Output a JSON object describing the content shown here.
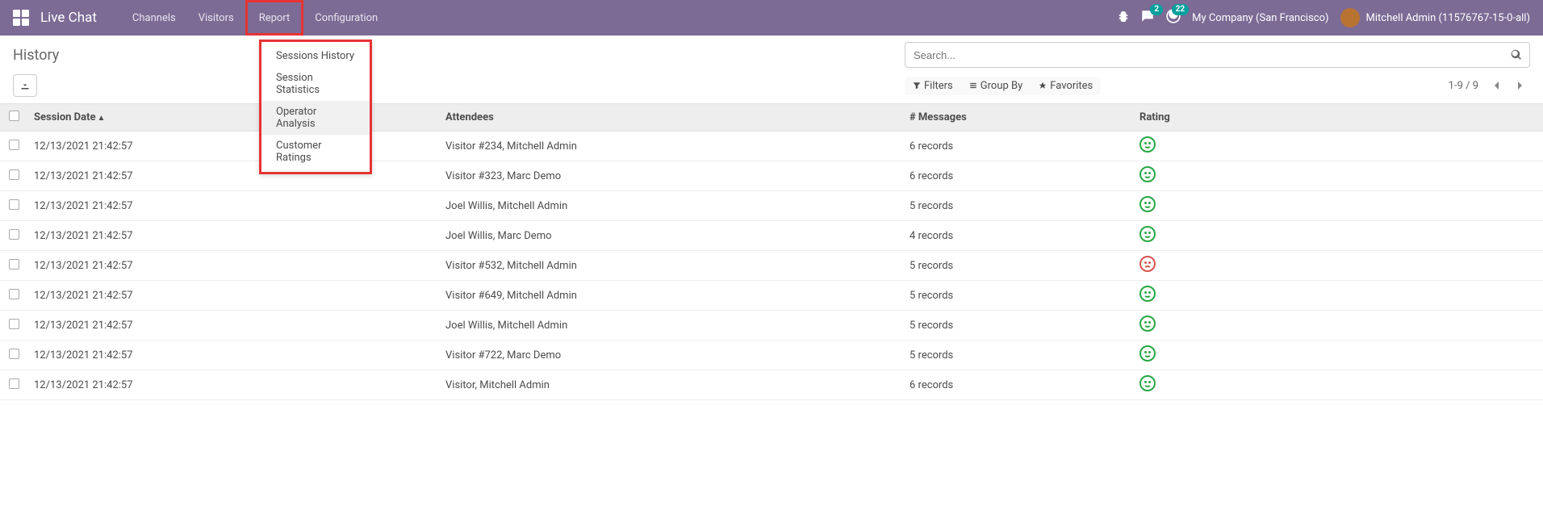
{
  "navbar": {
    "app_title": "Live Chat",
    "menu": [
      {
        "label": "Channels",
        "active": false
      },
      {
        "label": "Visitors",
        "active": false
      },
      {
        "label": "Report",
        "active": true,
        "highlight": true
      },
      {
        "label": "Configuration",
        "active": false
      }
    ],
    "messages_badge": "2",
    "activities_badge": "22",
    "company": "My Company (San Francisco)",
    "user": "Mitchell Admin (11576767-15-0-all)"
  },
  "dropdown": {
    "items": [
      {
        "label": "Sessions History"
      },
      {
        "label": "Session Statistics"
      },
      {
        "label": "Operator Analysis",
        "hover": true
      },
      {
        "label": "Customer Ratings"
      }
    ]
  },
  "control_panel": {
    "title": "History",
    "search_placeholder": "Search...",
    "filters_label": "Filters",
    "groupby_label": "Group By",
    "favorites_label": "Favorites",
    "pager": "1-9 / 9"
  },
  "table": {
    "headers": {
      "session_date": "Session Date",
      "attendees": "Attendees",
      "messages": "# Messages",
      "rating": "Rating"
    },
    "rows": [
      {
        "date": "12/13/2021 21:42:57",
        "attendees": "Visitor #234, Mitchell Admin",
        "messages": "6 records",
        "rating": "happy"
      },
      {
        "date": "12/13/2021 21:42:57",
        "attendees": "Visitor #323, Marc Demo",
        "messages": "6 records",
        "rating": "happy"
      },
      {
        "date": "12/13/2021 21:42:57",
        "attendees": "Joel Willis, Mitchell Admin",
        "messages": "5 records",
        "rating": "happy"
      },
      {
        "date": "12/13/2021 21:42:57",
        "attendees": "Joel Willis, Marc Demo",
        "messages": "4 records",
        "rating": "happy"
      },
      {
        "date": "12/13/2021 21:42:57",
        "attendees": "Visitor #532, Mitchell Admin",
        "messages": "5 records",
        "rating": "sad"
      },
      {
        "date": "12/13/2021 21:42:57",
        "attendees": "Visitor #649, Mitchell Admin",
        "messages": "5 records",
        "rating": "happy"
      },
      {
        "date": "12/13/2021 21:42:57",
        "attendees": "Joel Willis, Mitchell Admin",
        "messages": "5 records",
        "rating": "happy"
      },
      {
        "date": "12/13/2021 21:42:57",
        "attendees": "Visitor #722, Marc Demo",
        "messages": "5 records",
        "rating": "happy"
      },
      {
        "date": "12/13/2021 21:42:57",
        "attendees": "Visitor, Mitchell Admin",
        "messages": "6 records",
        "rating": "happy"
      }
    ]
  }
}
